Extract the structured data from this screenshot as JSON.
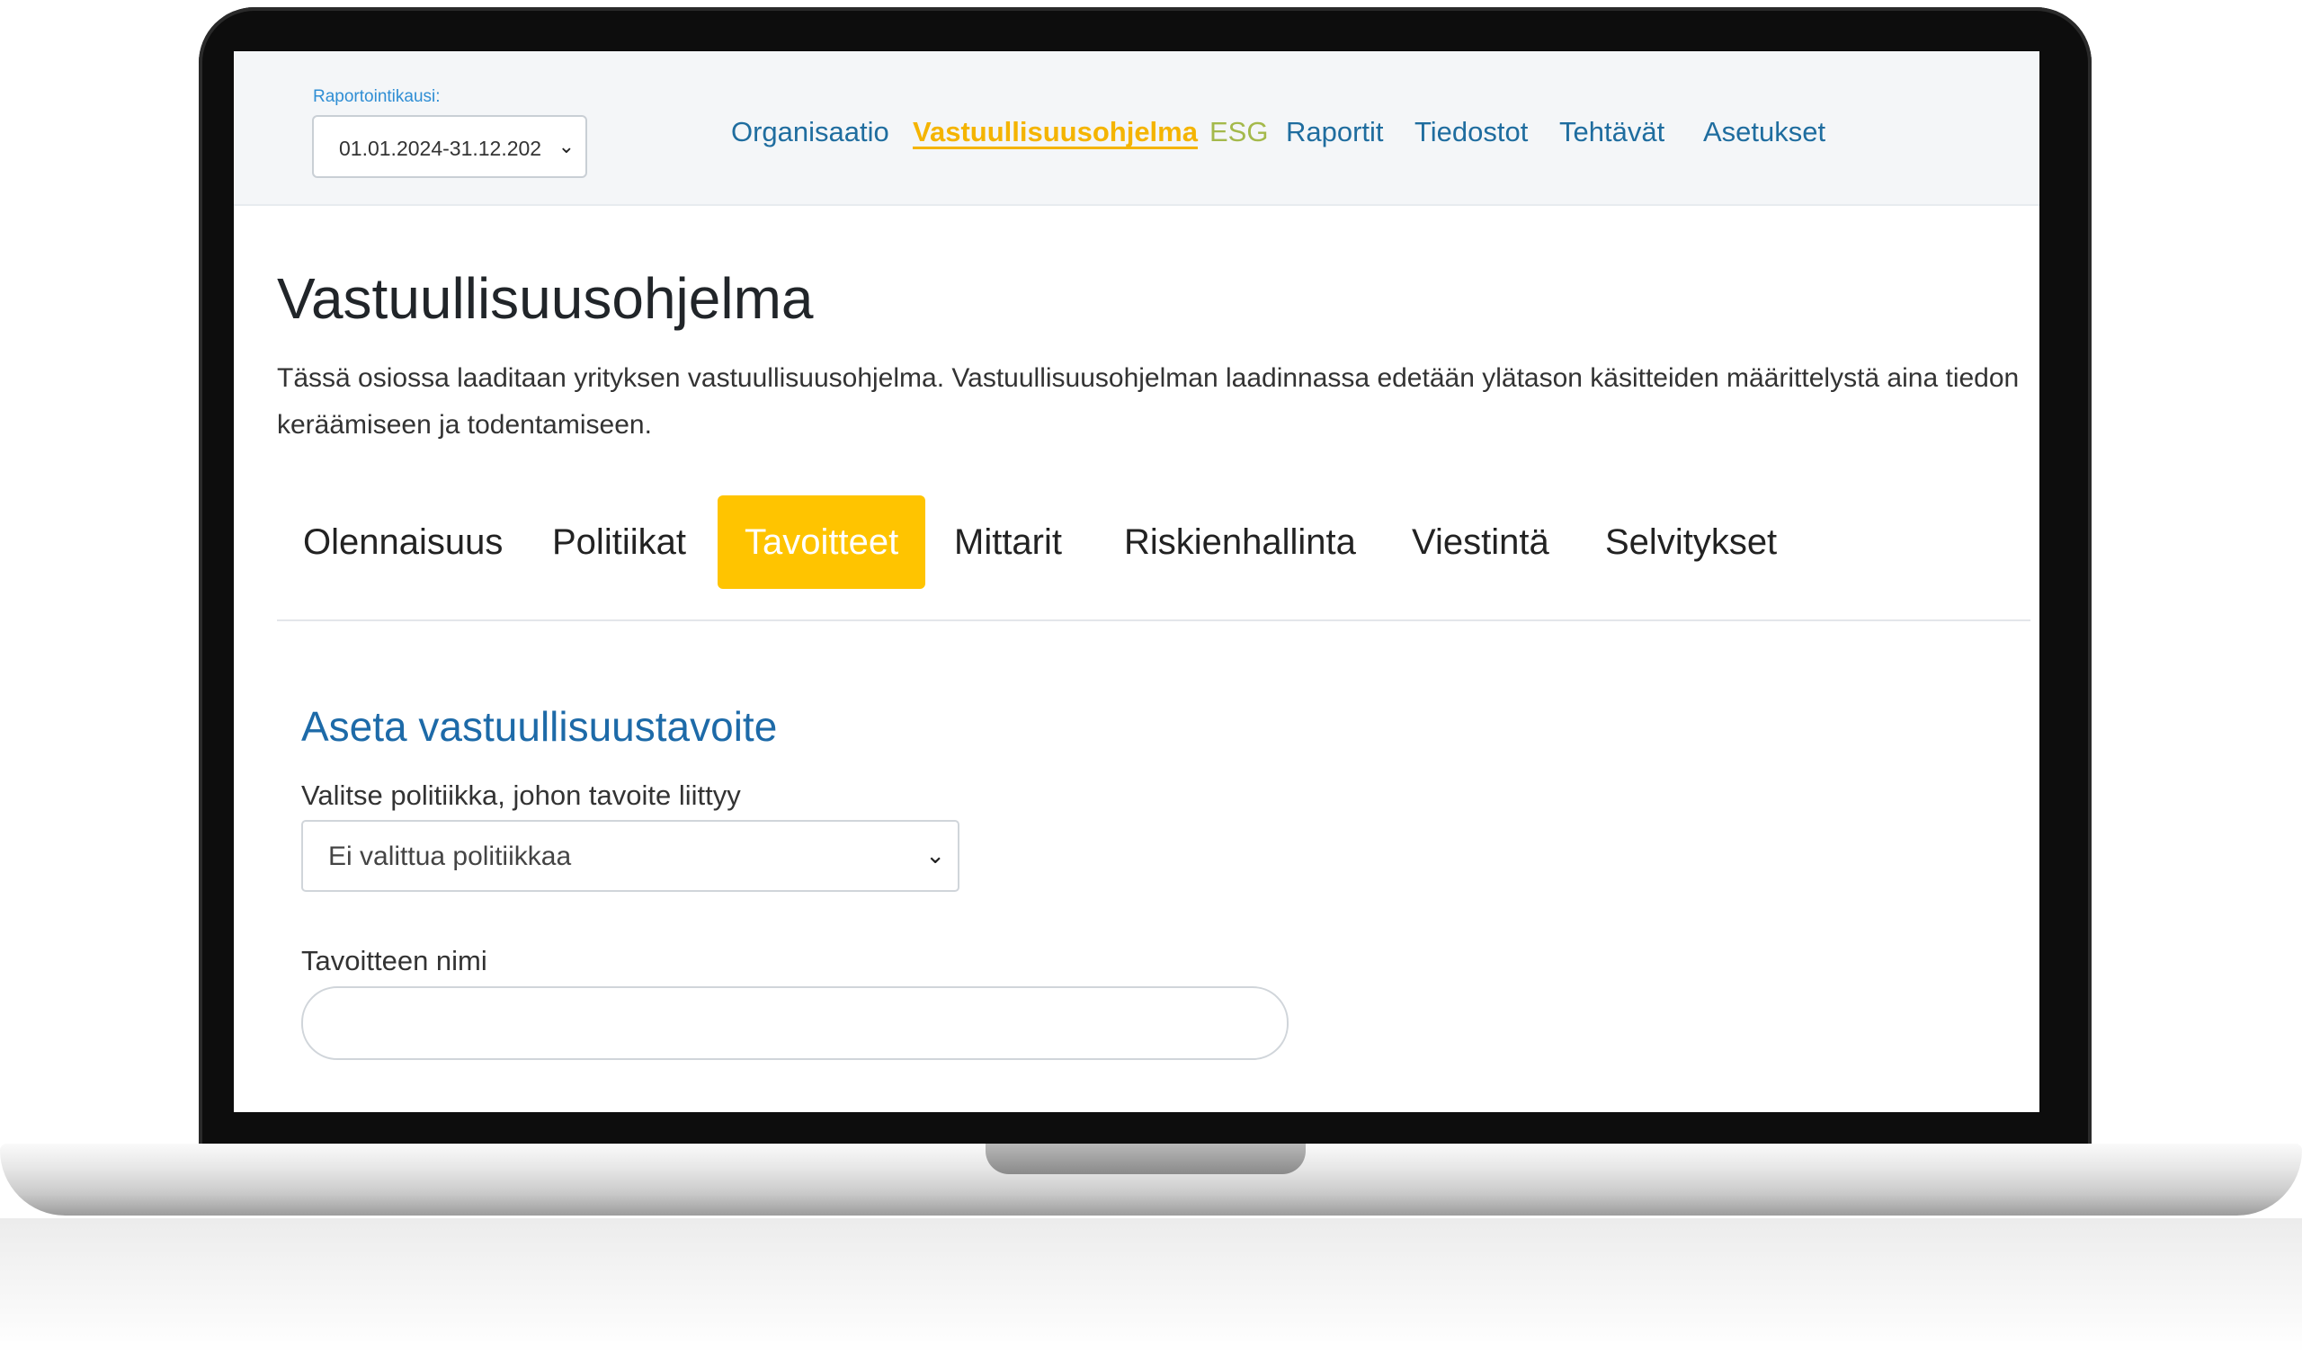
{
  "header": {
    "period_label": "Raportointikausi:",
    "period_value": "01.01.2024-31.12.202",
    "nav": [
      {
        "label": "Organisaatio"
      },
      {
        "label": "Vastuullisuusohjelma"
      },
      {
        "label": "ESG"
      },
      {
        "label": "Raportit"
      },
      {
        "label": "Tiedostot"
      },
      {
        "label": "Tehtävät"
      },
      {
        "label": "Asetukset"
      }
    ],
    "active_nav": "Vastuullisuusohjelma"
  },
  "page": {
    "title": "Vastuullisuusohjelma",
    "description": "Tässä osiossa laaditaan yrityksen vastuullisuusohjelma. Vastuullisuusohjelman laadinnassa edetään ylätason käsitteiden määrittelystä aina tiedon keräämiseen ja todentamiseen."
  },
  "tabs": [
    {
      "label": "Olennaisuus"
    },
    {
      "label": "Politiikat"
    },
    {
      "label": "Tavoitteet"
    },
    {
      "label": "Mittarit"
    },
    {
      "label": "Riskienhallinta"
    },
    {
      "label": "Viestintä"
    },
    {
      "label": "Selvitykset"
    }
  ],
  "active_tab": "Tavoitteet",
  "form": {
    "section_title": "Aseta vastuullisuustavoite",
    "policy_label": "Valitse politiikka, johon tavoite liittyy",
    "policy_value": "Ei valittua politiikkaa",
    "name_label": "Tavoitteen nimi",
    "name_value": ""
  },
  "colors": {
    "accent_yellow": "#ffc400",
    "nav_blue": "#1f6d9f",
    "esg_green": "#a4b94b",
    "heading_blue": "#1d6aa8"
  },
  "icons": {
    "select_chevron": "chevron-down-icon"
  }
}
